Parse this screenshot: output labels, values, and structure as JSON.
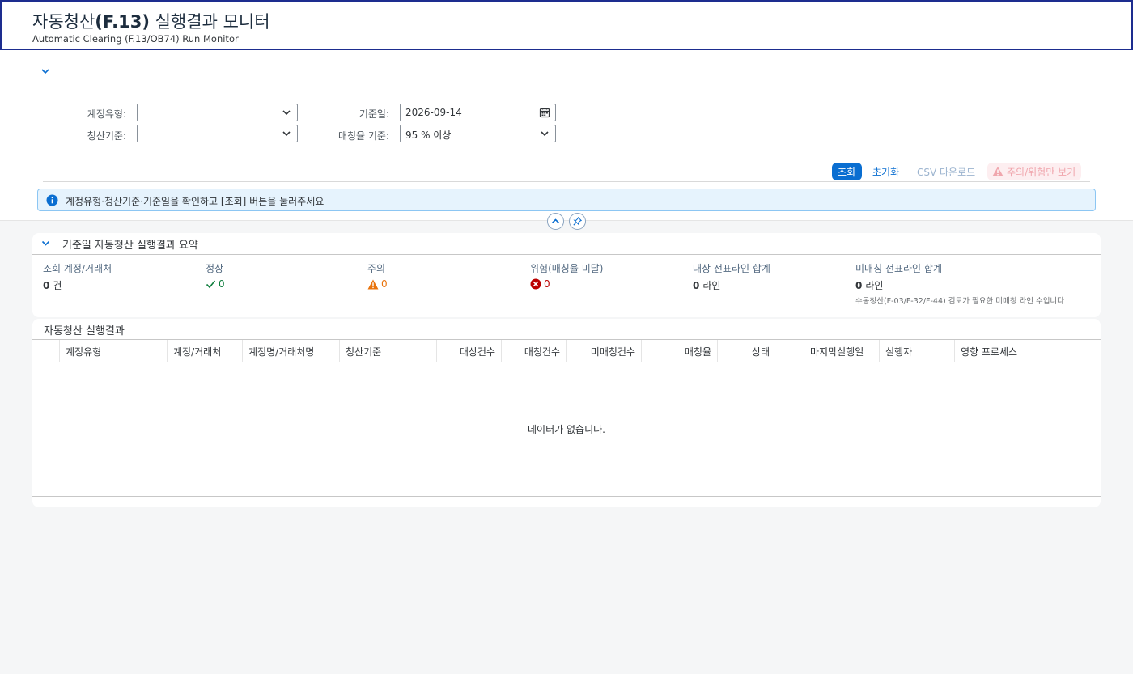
{
  "header": {
    "title_prefix": "자동청산",
    "title_code": "(F.13)",
    "title_suffix": " 실행결과 모니터",
    "subtitle": "Automatic Clearing (F.13/OB74) Run Monitor"
  },
  "filters": {
    "account_type_label": "계정유형:",
    "account_type_value": "",
    "clearing_basis_label": "청산기준:",
    "clearing_basis_value": "",
    "key_date_label": "기준일:",
    "key_date_value": "2026-09-14",
    "match_rate_label": "매칭율 기준:",
    "match_rate_value": "95 % 이상"
  },
  "toolbar": {
    "search_label": "조회",
    "reset_label": "초기화",
    "csv_label": "CSV 다운로드",
    "warn_only_label": "주의/위험만 보기"
  },
  "info_message": "계정유형·청산기준·기준일을 확인하고 [조회] 버튼을 눌러주세요",
  "summary": {
    "title": "기준일 자동청산 실행결과 요약",
    "kpis": [
      {
        "label": "조회 계정/거래처",
        "value": "0",
        "unit": "건"
      },
      {
        "label": "정상",
        "value": "0"
      },
      {
        "label": "주의",
        "value": "0"
      },
      {
        "label": "위험(매칭율 미달)",
        "value": "0"
      },
      {
        "label": "대상 전표라인 합계",
        "value": "0",
        "unit": "라인"
      },
      {
        "label": "미매칭 전표라인 합계",
        "value": "0",
        "unit": "라인",
        "note": "수동청산(F-03/F-32/F-44) 검토가 필요한 미매칭 라인 수입니다"
      }
    ]
  },
  "results": {
    "title": "자동청산 실행결과",
    "columns": [
      "계정유형",
      "계정/거래처",
      "계정명/거래처명",
      "청산기준",
      "대상건수",
      "매칭건수",
      "미매칭건수",
      "매칭율",
      "상태",
      "마지막실행일",
      "실행자",
      "영향 프로세스"
    ],
    "empty_text": "데이터가 없습니다."
  },
  "colors": {
    "accent": "#0a6ed1",
    "success": "#107e3e",
    "warning": "#e9730c",
    "error": "#bb0000"
  }
}
